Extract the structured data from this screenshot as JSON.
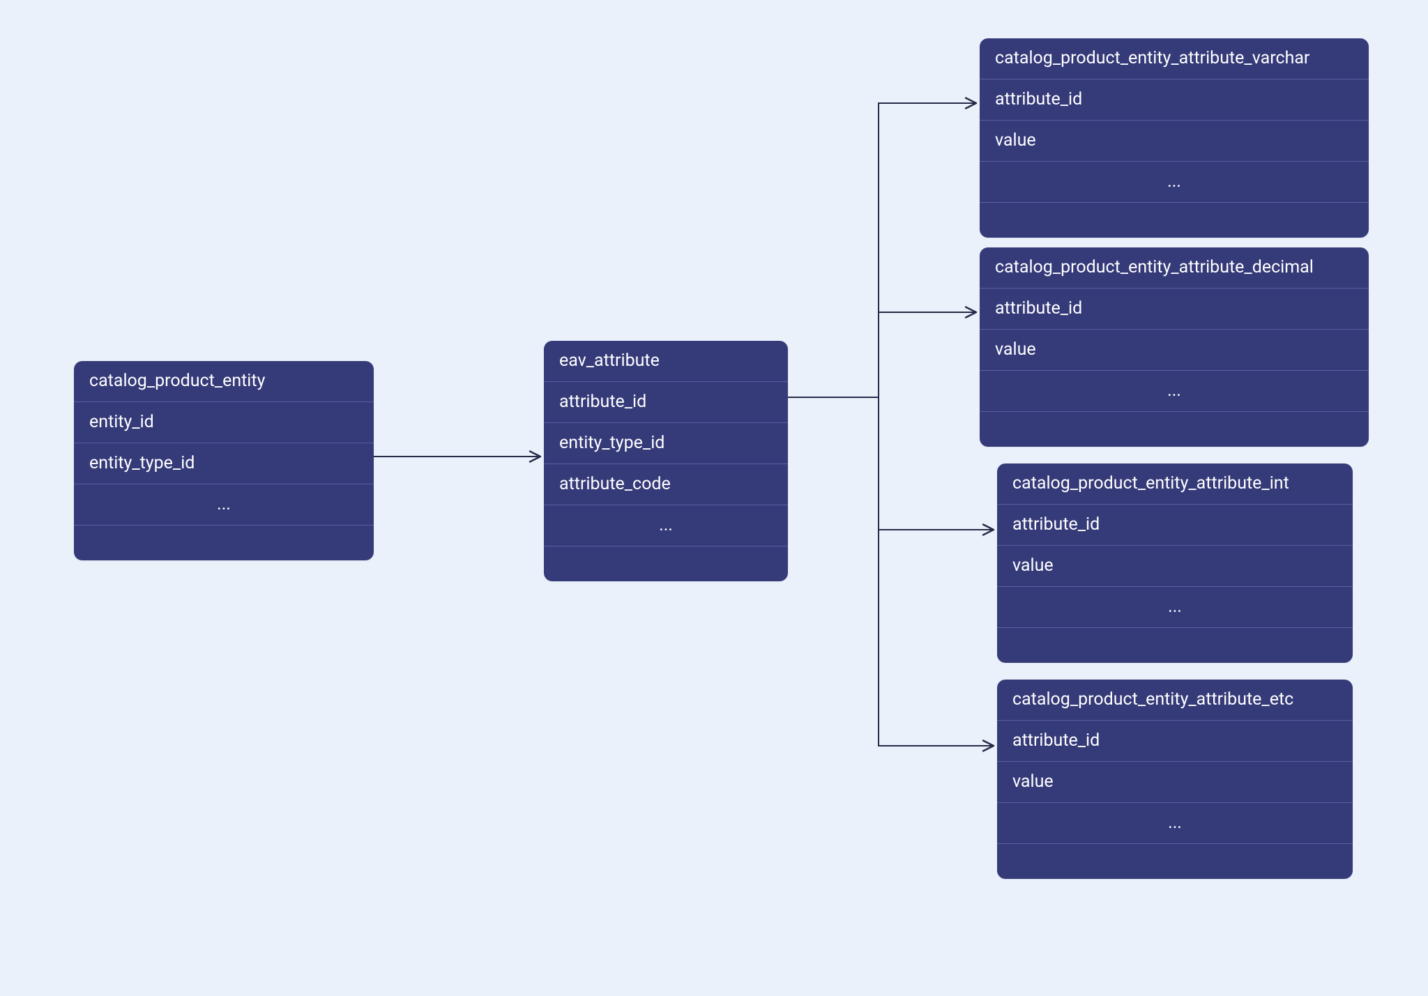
{
  "entities": {
    "catalog_product_entity": {
      "title": "catalog_product_entity",
      "rows": [
        "entity_id",
        "entity_type_id",
        "..."
      ]
    },
    "eav_attribute": {
      "title": "eav_attribute",
      "rows": [
        "attribute_id",
        "entity_type_id",
        "attribute_code",
        "..."
      ]
    },
    "varchar": {
      "title": "catalog_product_entity_attribute_varchar",
      "rows": [
        "attribute_id",
        "value",
        "..."
      ]
    },
    "decimal": {
      "title": "catalog_product_entity_attribute_decimal",
      "rows": [
        "attribute_id",
        "value",
        "..."
      ]
    },
    "int": {
      "title": "catalog_product_entity_attribute_int",
      "rows": [
        "attribute_id",
        "value",
        "..."
      ]
    },
    "etc": {
      "title": "catalog_product_entity_attribute_etc",
      "rows": [
        "attribute_id",
        "value",
        "..."
      ]
    }
  }
}
